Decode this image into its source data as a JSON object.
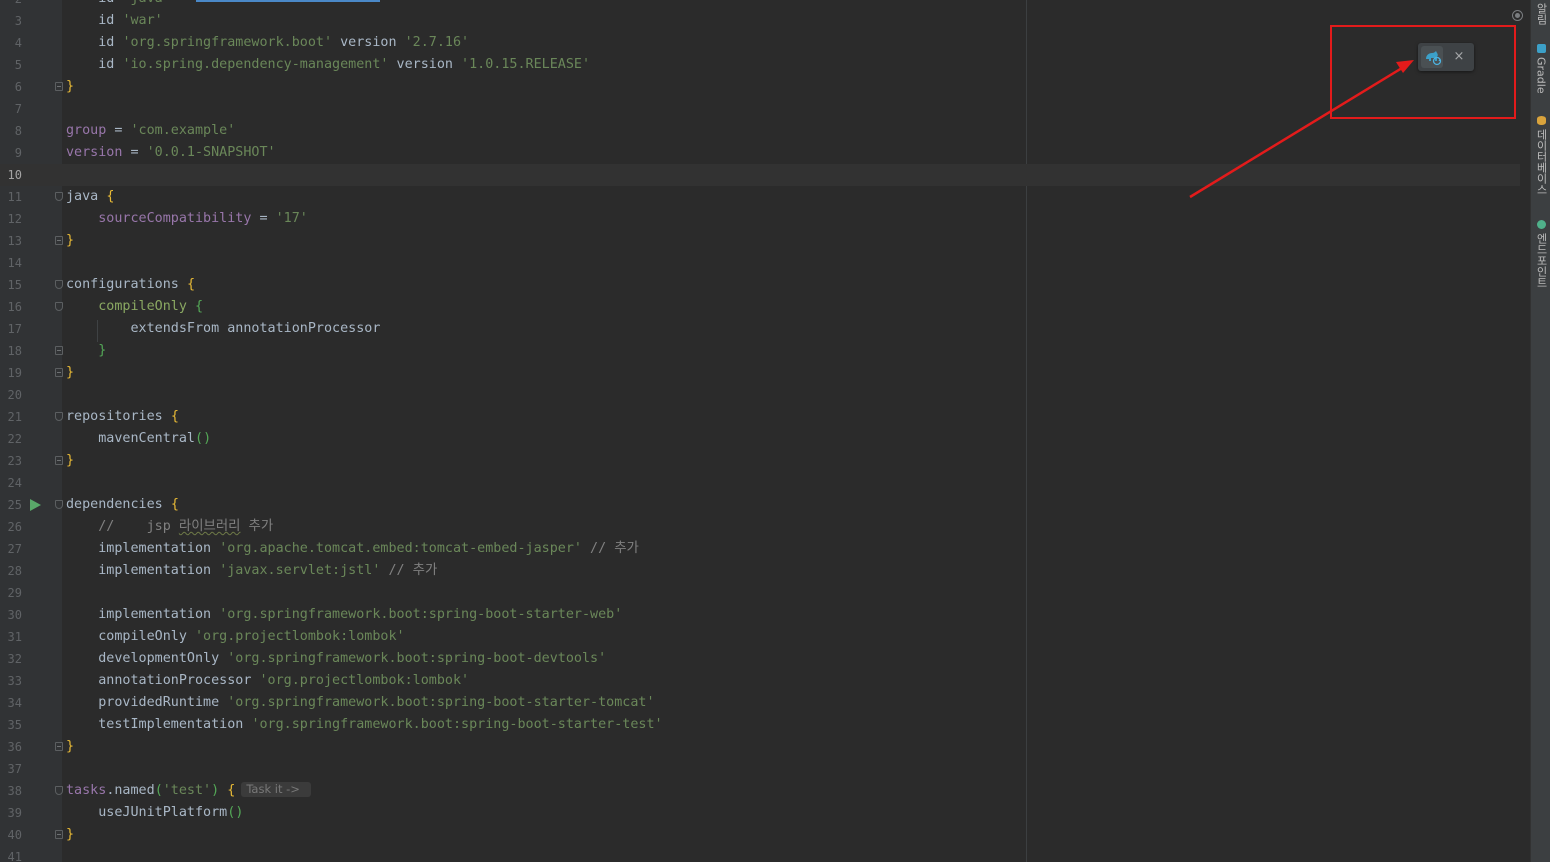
{
  "editor": {
    "current_line": "10",
    "lines": [
      {
        "num": "2",
        "code": "    id 'java'"
      },
      {
        "num": "3",
        "code": "    id 'war'"
      },
      {
        "num": "4",
        "code": "    id 'org.springframework.boot' version '2.7.16'"
      },
      {
        "num": "5",
        "code": "    id 'io.spring.dependency-management' version '1.0.15.RELEASE'"
      },
      {
        "num": "6",
        "code": "}"
      },
      {
        "num": "7",
        "code": ""
      },
      {
        "num": "8",
        "code": "group = 'com.example'"
      },
      {
        "num": "9",
        "code": "version = '0.0.1-SNAPSHOT'"
      },
      {
        "num": "10",
        "code": ""
      },
      {
        "num": "11",
        "code": "java {"
      },
      {
        "num": "12",
        "code": "    sourceCompatibility = '17'"
      },
      {
        "num": "13",
        "code": "}"
      },
      {
        "num": "14",
        "code": ""
      },
      {
        "num": "15",
        "code": "configurations {"
      },
      {
        "num": "16",
        "code": "    compileOnly {"
      },
      {
        "num": "17",
        "code": "        extendsFrom annotationProcessor"
      },
      {
        "num": "18",
        "code": "    }"
      },
      {
        "num": "19",
        "code": "}"
      },
      {
        "num": "20",
        "code": ""
      },
      {
        "num": "21",
        "code": "repositories {"
      },
      {
        "num": "22",
        "code": "    mavenCentral()"
      },
      {
        "num": "23",
        "code": "}"
      },
      {
        "num": "24",
        "code": ""
      },
      {
        "num": "25",
        "code": "dependencies {"
      },
      {
        "num": "26",
        "code": "    //    jsp 라이브러리 추가"
      },
      {
        "num": "27",
        "code": "    implementation 'org.apache.tomcat.embed:tomcat-embed-jasper' // 추가"
      },
      {
        "num": "28",
        "code": "    implementation 'javax.servlet:jstl' // 추가"
      },
      {
        "num": "29",
        "code": ""
      },
      {
        "num": "30",
        "code": "    implementation 'org.springframework.boot:spring-boot-starter-web'"
      },
      {
        "num": "31",
        "code": "    compileOnly 'org.projectlombok:lombok'"
      },
      {
        "num": "32",
        "code": "    developmentOnly 'org.springframework.boot:spring-boot-devtools'"
      },
      {
        "num": "33",
        "code": "    annotationProcessor 'org.projectlombok:lombok'"
      },
      {
        "num": "34",
        "code": "    providedRuntime 'org.springframework.boot:spring-boot-starter-tomcat'"
      },
      {
        "num": "35",
        "code": "    testImplementation 'org.springframework.boot:spring-boot-starter-test'"
      },
      {
        "num": "36",
        "code": "}"
      },
      {
        "num": "37",
        "code": ""
      },
      {
        "num": "38",
        "code": "tasks.named('test') {"
      },
      {
        "num": "39",
        "code": "    useJUnitPlatform()"
      },
      {
        "num": "40",
        "code": "}"
      },
      {
        "num": "41",
        "code": ""
      }
    ],
    "inlay_hint": "Task it ->"
  },
  "right_sidebar": {
    "tabs": [
      {
        "label": "알림"
      },
      {
        "label": "Gradle",
        "icon": "gradle-elephant-icon"
      },
      {
        "label": "데이터베이스",
        "icon": "database-icon"
      },
      {
        "label": "엔드포인트",
        "icon": "endpoints-icon"
      }
    ]
  },
  "gradle_popup": {
    "sync_icon": "gradle-sync-icon",
    "close_glyph": "×"
  },
  "colors": {
    "annotation": "#e31b1b",
    "editor_bg": "#2b2b2b",
    "string": "#6a8759",
    "property": "#9876aa"
  }
}
